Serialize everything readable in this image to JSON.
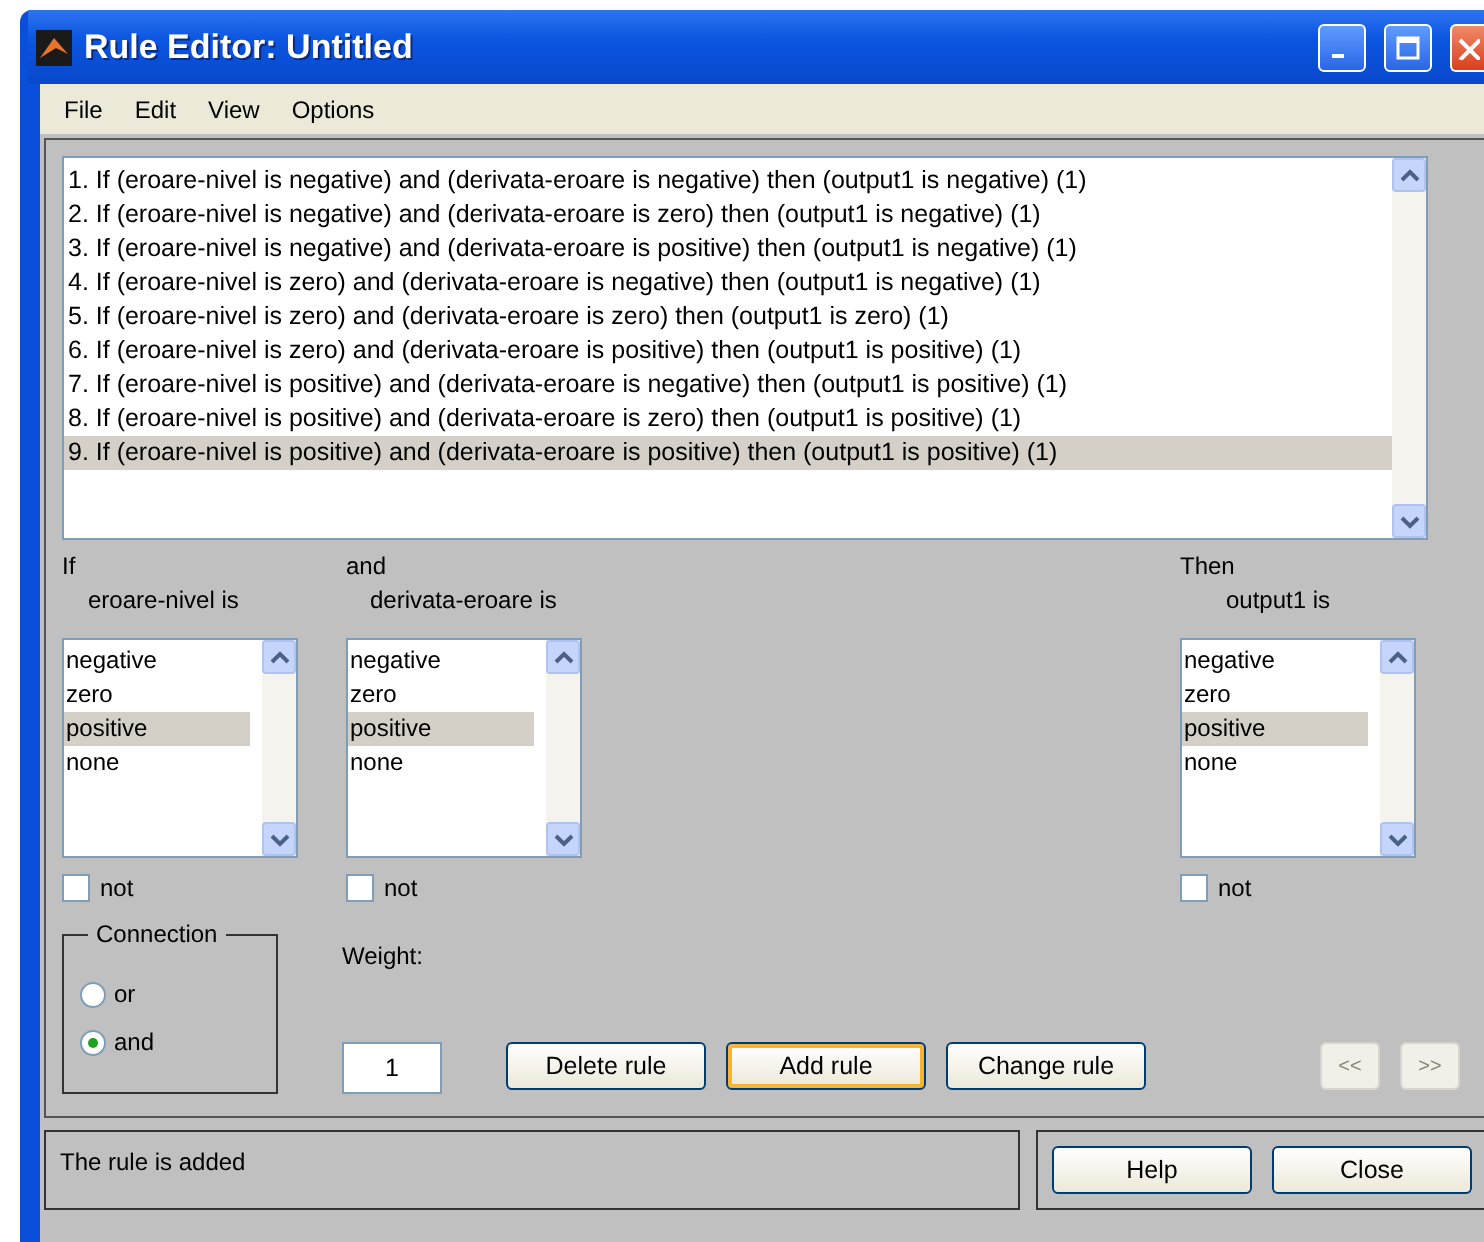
{
  "window": {
    "title": "Rule Editor: Untitled"
  },
  "menu": [
    "File",
    "Edit",
    "View",
    "Options"
  ],
  "rules": [
    {
      "text": "1. If (eroare-nivel is negative) and (derivata-eroare is negative) then (output1 is negative) (1)",
      "selected": false
    },
    {
      "text": "2. If (eroare-nivel is negative) and (derivata-eroare is zero) then (output1 is negative) (1)",
      "selected": false
    },
    {
      "text": "3. If (eroare-nivel is negative) and (derivata-eroare is positive) then (output1 is negative) (1)",
      "selected": false
    },
    {
      "text": "4. If (eroare-nivel is zero) and (derivata-eroare is negative) then (output1 is negative) (1)",
      "selected": false
    },
    {
      "text": "5. If (eroare-nivel is zero) and (derivata-eroare is zero) then (output1 is zero) (1)",
      "selected": false
    },
    {
      "text": "6. If (eroare-nivel is zero) and (derivata-eroare is positive) then (output1 is positive) (1)",
      "selected": false
    },
    {
      "text": "7. If (eroare-nivel is positive) and (derivata-eroare is negative) then (output1 is positive) (1)",
      "selected": false
    },
    {
      "text": "8. If (eroare-nivel is positive) and (derivata-eroare is zero) then (output1 is positive) (1)",
      "selected": false
    },
    {
      "text": "9. If (eroare-nivel is positive) and (derivata-eroare is positive) then (output1 is positive) (1)",
      "selected": true
    }
  ],
  "variables": [
    {
      "heading": "If",
      "label": "eroare-nivel is",
      "items": [
        {
          "text": "negative",
          "selected": false
        },
        {
          "text": "zero",
          "selected": false
        },
        {
          "text": "positive",
          "selected": true
        },
        {
          "text": "none",
          "selected": false
        }
      ],
      "not": {
        "label": "not",
        "checked": false
      }
    },
    {
      "heading": "and",
      "label": "derivata-eroare is",
      "items": [
        {
          "text": "negative",
          "selected": false
        },
        {
          "text": "zero",
          "selected": false
        },
        {
          "text": "positive",
          "selected": true
        },
        {
          "text": "none",
          "selected": false
        }
      ],
      "not": {
        "label": "not",
        "checked": false
      }
    },
    {
      "heading": "Then",
      "label": "output1 is",
      "items": [
        {
          "text": "negative",
          "selected": false
        },
        {
          "text": "zero",
          "selected": false
        },
        {
          "text": "positive",
          "selected": true
        },
        {
          "text": "none",
          "selected": false
        }
      ],
      "not": {
        "label": "not",
        "checked": false
      }
    }
  ],
  "connection": {
    "title": "Connection",
    "options": [
      {
        "label": "or",
        "selected": false
      },
      {
        "label": "and",
        "selected": true
      }
    ]
  },
  "weight": {
    "label": "Weight:",
    "value": "1"
  },
  "rule_buttons": [
    {
      "label": "Delete rule",
      "focused": false
    },
    {
      "label": "Add rule",
      "focused": true
    },
    {
      "label": "Change rule",
      "focused": false
    }
  ],
  "nav_buttons": [
    {
      "label": "<<",
      "disabled": true
    },
    {
      "label": ">>",
      "disabled": true
    }
  ],
  "status": "The rule is added",
  "footer_buttons": [
    {
      "label": "Help"
    },
    {
      "label": "Close"
    }
  ]
}
